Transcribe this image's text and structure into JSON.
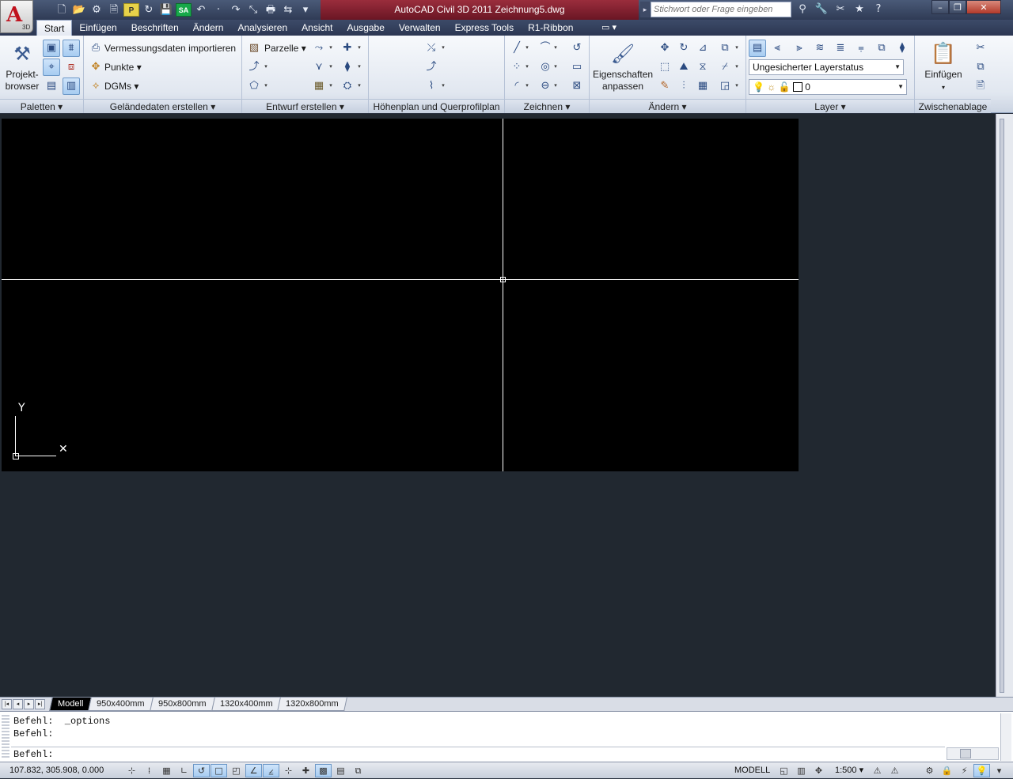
{
  "title_bar": {
    "window_title": "AutoCAD Civil 3D 2011    Zeichnung5.dwg",
    "logo_letter": "A",
    "logo_badge": "3D",
    "search_placeholder": "Stichwort oder Frage eingeben",
    "qat": [
      {
        "name": "new-icon",
        "glyph": "🗋"
      },
      {
        "name": "open-icon",
        "glyph": "📂"
      },
      {
        "name": "civil-icon",
        "glyph": "⚙"
      },
      {
        "name": "sheet-icon",
        "glyph": "🗎"
      },
      {
        "name": "yellow-tool-icon",
        "glyph": "P"
      },
      {
        "name": "refresh-icon",
        "glyph": "↻"
      },
      {
        "name": "save-icon",
        "glyph": "💾"
      },
      {
        "name": "sa-icon",
        "glyph": "SA"
      },
      {
        "name": "undo-icon",
        "glyph": "↶"
      },
      {
        "name": "undo-dropdown-icon",
        "glyph": "·"
      },
      {
        "name": "redo-icon",
        "glyph": "↷"
      },
      {
        "name": "fullscreen-icon",
        "glyph": "⤡"
      },
      {
        "name": "print-icon",
        "glyph": "🖶"
      },
      {
        "name": "publish-icon",
        "glyph": "⇆"
      },
      {
        "name": "qat-more-icon",
        "glyph": "▾"
      }
    ],
    "info_tools": [
      {
        "name": "binoculars-icon",
        "glyph": "⚲"
      },
      {
        "name": "tools-icon",
        "glyph": "🔧"
      },
      {
        "name": "satellite-icon",
        "glyph": "✂"
      },
      {
        "name": "star-icon",
        "glyph": "★"
      },
      {
        "name": "help-icon",
        "glyph": "?"
      }
    ]
  },
  "tabs": [
    "Start",
    "Einfügen",
    "Beschriften",
    "Ändern",
    "Analysieren",
    "Ansicht",
    "Ausgabe",
    "Verwalten",
    "Express Tools",
    "R1-Ribbon"
  ],
  "active_tab": "Start",
  "ribbon": {
    "paletten": {
      "title": "Paletten",
      "big_label_1": "Projekt-",
      "big_label_2": "browser"
    },
    "gelaende": {
      "title": "Geländedaten erstellen",
      "item1": "Vermessungsdaten importieren",
      "item2": "Punkte",
      "item3": "DGMs"
    },
    "entwurf": {
      "title": "Entwurf erstellen",
      "item1": "Parzelle"
    },
    "hoehenplan": {
      "title": "Höhenplan und Querprofilplan"
    },
    "zeichnen": {
      "title": "Zeichnen"
    },
    "aendern": {
      "title": "Ändern",
      "big_label_1": "Eigenschaften",
      "big_label_2": "anpassen"
    },
    "layer": {
      "title": "Layer",
      "layer_state": "Ungesicherter Layerstatus",
      "current_layer": "0"
    },
    "clipboard": {
      "title": "Zwischenablage",
      "big_label": "Einfügen"
    }
  },
  "layout_tabs": [
    "Modell",
    "950x400mm",
    "950x800mm",
    "1320x400mm",
    "1320x800mm"
  ],
  "active_layout": "Modell",
  "command_line": {
    "history_1": "Befehl:  _options",
    "history_2": "Befehl:",
    "prompt": "Befehl:"
  },
  "status_bar": {
    "coordinates": "107.832, 305.908, 0.000",
    "space": "MODELL",
    "scale": "1:500"
  },
  "colors": {
    "drawing_background": "#000000",
    "crosshair": "#ffffff",
    "title_bar_center": "#8a2233"
  }
}
